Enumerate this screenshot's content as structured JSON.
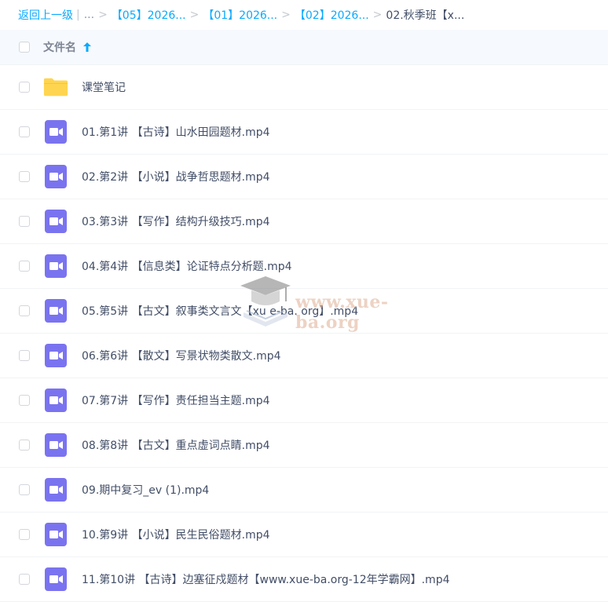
{
  "breadcrumb": {
    "back": "返回上一级",
    "pipe": "|",
    "ellipsis": "...",
    "sep": ">",
    "items": [
      "【05】2026...",
      "【01】2026...",
      "【02】2026...",
      "02.秋季班【x..."
    ]
  },
  "header": {
    "column_name": "文件名",
    "sort_icon": "arrow-up-icon"
  },
  "files": [
    {
      "name": "课堂笔记",
      "type": "folder"
    },
    {
      "name": "01.第1讲 【古诗】山水田园题材.mp4",
      "type": "video"
    },
    {
      "name": "02.第2讲 【小说】战争哲思题材.mp4",
      "type": "video"
    },
    {
      "name": "03.第3讲 【写作】结构升级技巧.mp4",
      "type": "video"
    },
    {
      "name": "04.第4讲 【信息类】论证特点分析题.mp4",
      "type": "video"
    },
    {
      "name": "05.第5讲 【古文】叙事类文言文【xu e-ba. org】.mp4",
      "type": "video"
    },
    {
      "name": "06.第6讲 【散文】写景状物类散文.mp4",
      "type": "video"
    },
    {
      "name": "07.第7讲 【写作】责任担当主题.mp4",
      "type": "video"
    },
    {
      "name": "08.第8讲 【古文】重点虚词点睛.mp4",
      "type": "video"
    },
    {
      "name": "09.期中复习_ev (1).mp4",
      "type": "video"
    },
    {
      "name": "10.第9讲 【小说】民生民俗题材.mp4",
      "type": "video"
    },
    {
      "name": "11.第10讲 【古诗】边塞征戍题材【www.xue-ba.org-12年学霸网】.mp4",
      "type": "video"
    }
  ],
  "watermark": {
    "text": "www.xue-ba.org",
    "icon": "graduation-cap-book-icon"
  },
  "colors": {
    "link": "#09aaff",
    "folder": "#ffd54f",
    "video": "#7a73f0",
    "header_bg": "#f6f9fd"
  }
}
